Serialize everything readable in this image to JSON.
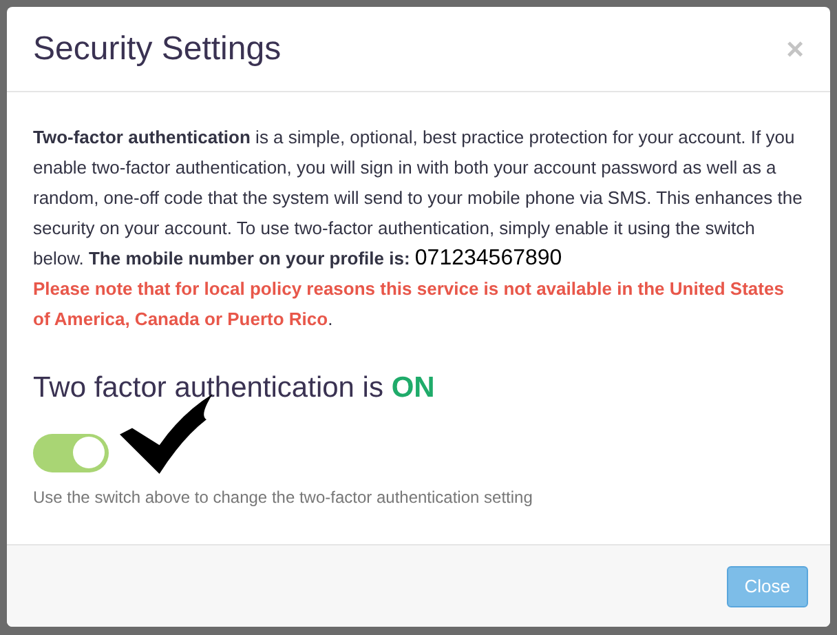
{
  "dialog": {
    "title": "Security Settings",
    "close_symbol": "×",
    "intro": "**Two-factor authentication** is a simple, optional, best practice protection for your account. If you enable two-factor authentication, you will sign in with both your account password as well as a random, one-off code that the system will send to your mobile phone via SMS. This enhances the security on your account. To use two-factor authentication, simply enable it using the switch below. **The mobile number on your profile is:**",
    "phone": "071234567890",
    "warning": "Please note that for local policy reasons this service is not available in the United States of America, Canada or Puerto Rico",
    "warning_end": ".",
    "status_label": "Two factor authentication is",
    "status_value": "ON",
    "switch": {
      "on": true
    },
    "hint": "Use the switch above to change the two-factor authentication setting",
    "buttons": [
      "Close"
    ]
  }
}
